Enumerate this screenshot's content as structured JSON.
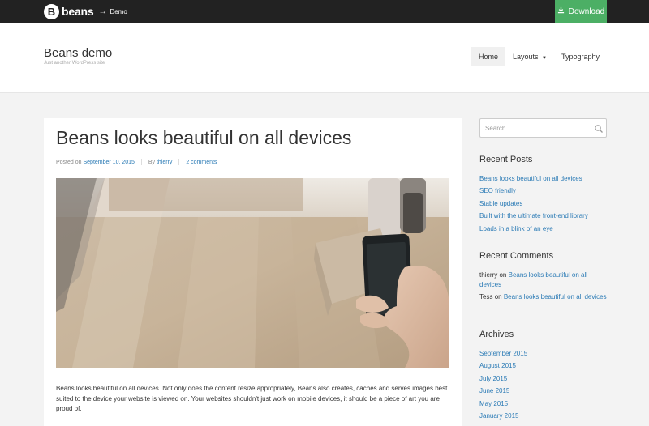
{
  "topbar": {
    "logo_mark": "B",
    "logo_word": "beans",
    "logo_arrow": "→",
    "logo_suffix": "Demo",
    "download_label": "Download",
    "download_icon": "download-icon",
    "accent_color": "#4caf65"
  },
  "header": {
    "site_title": "Beans demo",
    "tagline": "Just another WordPress site",
    "nav": [
      {
        "label": "Home",
        "active": true
      },
      {
        "label": "Layouts",
        "has_dropdown": true
      },
      {
        "label": "Typography"
      }
    ]
  },
  "post": {
    "title": "Beans looks beautiful on all devices",
    "meta_posted_prefix": "Posted on",
    "meta_date": "September 10, 2015",
    "meta_by_prefix": "By",
    "meta_author": "thierry",
    "meta_comments": "2 comments",
    "excerpt": "Beans looks beautiful on all devices. Not only does the content resize appropriately, Beans also creates, caches and serves images best suited to the device your website is viewed on. Your websites shouldn't just work on mobile devices, it should be a piece of art you are proud of."
  },
  "sidebar": {
    "search_placeholder": "Search",
    "recent_posts_title": "Recent Posts",
    "recent_posts": [
      "Beans looks beautiful on all devices",
      "SEO friendly",
      "Stable updates",
      "Built with the ultimate front-end library",
      "Loads in a blink of an eye"
    ],
    "recent_comments_title": "Recent Comments",
    "recent_comments": [
      {
        "author": "thierry",
        "on": "on",
        "post": "Beans looks beautiful on all devices"
      },
      {
        "author": "Tess",
        "on": "on",
        "post": "Beans looks beautiful on all devices"
      }
    ],
    "archives_title": "Archives",
    "archives": [
      "September 2015",
      "August 2015",
      "July 2015",
      "June 2015",
      "May 2015",
      "January 2015"
    ]
  },
  "colors": {
    "link": "#2a7ab5",
    "topbar_bg": "#222222",
    "page_bg": "#f3f3f3"
  }
}
